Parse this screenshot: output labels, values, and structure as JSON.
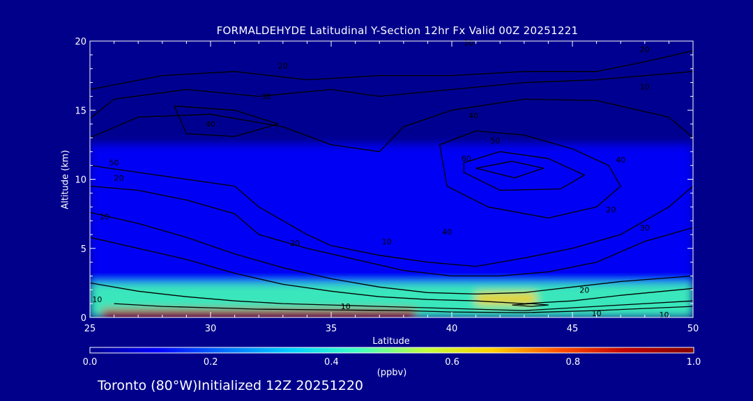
{
  "chart_data": {
    "type": "heatmap",
    "title": "FORMALDEHYDE Latitudinal Y-Section 12hr  Fx Valid 00Z 20251221",
    "xlabel": "Latitude",
    "ylabel": "Altitude (km)",
    "xlim": [
      25,
      50
    ],
    "ylim": [
      0,
      20
    ],
    "x_ticks": [
      "25",
      "30",
      "35",
      "40",
      "45",
      "50"
    ],
    "y_ticks": [
      "0",
      "5",
      "10",
      "15",
      "20"
    ],
    "colorbar": {
      "label": "(ppbv)",
      "range": [
        0.0,
        1.0
      ],
      "ticks": [
        "0.0",
        "0.2",
        "0.4",
        "0.6",
        "0.8",
        "1.0"
      ],
      "colors": [
        "#000090",
        "#0000ff",
        "#0070ff",
        "#00d0ff",
        "#40ffc0",
        "#c0ff40",
        "#ffd000",
        "#ff5000",
        "#c00000",
        "#800000"
      ]
    },
    "field_features": [
      {
        "lat_min": 25.5,
        "lat_max": 38.5,
        "alt_min": 0.0,
        "alt_max": 0.6,
        "value": 0.9
      },
      {
        "lat_min": 41.0,
        "lat_max": 43.5,
        "alt_min": 0.9,
        "alt_max": 1.8,
        "value": 0.7
      },
      {
        "lat_min": 25.0,
        "lat_max": 50.0,
        "alt_min": 0.0,
        "alt_max": 2.5,
        "value": 0.4
      },
      {
        "lat_min": 25.0,
        "lat_max": 50.0,
        "alt_min": 2.5,
        "alt_max": 12.5,
        "value": 0.15
      },
      {
        "lat_min": 25.0,
        "lat_max": 50.0,
        "alt_min": 12.5,
        "alt_max": 20.0,
        "value": 0.05
      }
    ],
    "contour_labels": [
      {
        "text": "10",
        "lat": 40.7,
        "alt": 19.9
      },
      {
        "text": "20",
        "lat": 33.0,
        "alt": 18.2
      },
      {
        "text": "30",
        "lat": 32.3,
        "alt": 16.0
      },
      {
        "text": "40",
        "lat": 30.0,
        "alt": 14.0
      },
      {
        "text": "20",
        "lat": 48.0,
        "alt": 19.4
      },
      {
        "text": "10",
        "lat": 48.0,
        "alt": 16.7
      },
      {
        "text": "40",
        "lat": 40.9,
        "alt": 14.6
      },
      {
        "text": "50",
        "lat": 41.8,
        "alt": 12.8
      },
      {
        "text": "60",
        "lat": 40.6,
        "alt": 11.5
      },
      {
        "text": "40",
        "lat": 47.0,
        "alt": 11.4
      },
      {
        "text": "50",
        "lat": 26.0,
        "alt": 11.2
      },
      {
        "text": "20",
        "lat": 26.2,
        "alt": 10.1
      },
      {
        "text": "10",
        "lat": 25.6,
        "alt": 7.3
      },
      {
        "text": "20",
        "lat": 33.5,
        "alt": 5.4
      },
      {
        "text": "30",
        "lat": 48.0,
        "alt": 6.5
      },
      {
        "text": "20",
        "lat": 46.6,
        "alt": 7.8
      },
      {
        "text": "40",
        "lat": 39.8,
        "alt": 6.2
      },
      {
        "text": "10",
        "lat": 37.3,
        "alt": 5.5
      },
      {
        "text": "20",
        "lat": 45.5,
        "alt": 2.0
      },
      {
        "text": "10",
        "lat": 35.6,
        "alt": 0.8
      },
      {
        "text": "10",
        "lat": 46.0,
        "alt": 0.3
      },
      {
        "text": "10",
        "lat": 48.8,
        "alt": 0.2
      },
      {
        "text": "10",
        "lat": 25.3,
        "alt": 1.3
      }
    ]
  },
  "footer": "Toronto (80°W)Initialized 12Z 20251220",
  "colors": {
    "background": "#00008b",
    "text": "#ffffff",
    "contour": "#000000"
  }
}
